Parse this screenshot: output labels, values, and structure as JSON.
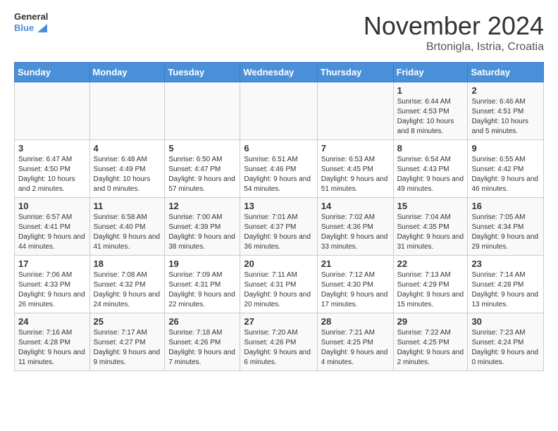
{
  "header": {
    "logo_line1": "General",
    "logo_line2": "Blue",
    "month": "November 2024",
    "location": "Brtonigla, Istria, Croatia"
  },
  "weekdays": [
    "Sunday",
    "Monday",
    "Tuesday",
    "Wednesday",
    "Thursday",
    "Friday",
    "Saturday"
  ],
  "weeks": [
    [
      {
        "day": "",
        "info": ""
      },
      {
        "day": "",
        "info": ""
      },
      {
        "day": "",
        "info": ""
      },
      {
        "day": "",
        "info": ""
      },
      {
        "day": "",
        "info": ""
      },
      {
        "day": "1",
        "info": "Sunrise: 6:44 AM\nSunset: 4:53 PM\nDaylight: 10 hours and 8 minutes."
      },
      {
        "day": "2",
        "info": "Sunrise: 6:46 AM\nSunset: 4:51 PM\nDaylight: 10 hours and 5 minutes."
      }
    ],
    [
      {
        "day": "3",
        "info": "Sunrise: 6:47 AM\nSunset: 4:50 PM\nDaylight: 10 hours and 2 minutes."
      },
      {
        "day": "4",
        "info": "Sunrise: 6:48 AM\nSunset: 4:49 PM\nDaylight: 10 hours and 0 minutes."
      },
      {
        "day": "5",
        "info": "Sunrise: 6:50 AM\nSunset: 4:47 PM\nDaylight: 9 hours and 57 minutes."
      },
      {
        "day": "6",
        "info": "Sunrise: 6:51 AM\nSunset: 4:46 PM\nDaylight: 9 hours and 54 minutes."
      },
      {
        "day": "7",
        "info": "Sunrise: 6:53 AM\nSunset: 4:45 PM\nDaylight: 9 hours and 51 minutes."
      },
      {
        "day": "8",
        "info": "Sunrise: 6:54 AM\nSunset: 4:43 PM\nDaylight: 9 hours and 49 minutes."
      },
      {
        "day": "9",
        "info": "Sunrise: 6:55 AM\nSunset: 4:42 PM\nDaylight: 9 hours and 46 minutes."
      }
    ],
    [
      {
        "day": "10",
        "info": "Sunrise: 6:57 AM\nSunset: 4:41 PM\nDaylight: 9 hours and 44 minutes."
      },
      {
        "day": "11",
        "info": "Sunrise: 6:58 AM\nSunset: 4:40 PM\nDaylight: 9 hours and 41 minutes."
      },
      {
        "day": "12",
        "info": "Sunrise: 7:00 AM\nSunset: 4:39 PM\nDaylight: 9 hours and 38 minutes."
      },
      {
        "day": "13",
        "info": "Sunrise: 7:01 AM\nSunset: 4:37 PM\nDaylight: 9 hours and 36 minutes."
      },
      {
        "day": "14",
        "info": "Sunrise: 7:02 AM\nSunset: 4:36 PM\nDaylight: 9 hours and 33 minutes."
      },
      {
        "day": "15",
        "info": "Sunrise: 7:04 AM\nSunset: 4:35 PM\nDaylight: 9 hours and 31 minutes."
      },
      {
        "day": "16",
        "info": "Sunrise: 7:05 AM\nSunset: 4:34 PM\nDaylight: 9 hours and 29 minutes."
      }
    ],
    [
      {
        "day": "17",
        "info": "Sunrise: 7:06 AM\nSunset: 4:33 PM\nDaylight: 9 hours and 26 minutes."
      },
      {
        "day": "18",
        "info": "Sunrise: 7:08 AM\nSunset: 4:32 PM\nDaylight: 9 hours and 24 minutes."
      },
      {
        "day": "19",
        "info": "Sunrise: 7:09 AM\nSunset: 4:31 PM\nDaylight: 9 hours and 22 minutes."
      },
      {
        "day": "20",
        "info": "Sunrise: 7:11 AM\nSunset: 4:31 PM\nDaylight: 9 hours and 20 minutes."
      },
      {
        "day": "21",
        "info": "Sunrise: 7:12 AM\nSunset: 4:30 PM\nDaylight: 9 hours and 17 minutes."
      },
      {
        "day": "22",
        "info": "Sunrise: 7:13 AM\nSunset: 4:29 PM\nDaylight: 9 hours and 15 minutes."
      },
      {
        "day": "23",
        "info": "Sunrise: 7:14 AM\nSunset: 4:28 PM\nDaylight: 9 hours and 13 minutes."
      }
    ],
    [
      {
        "day": "24",
        "info": "Sunrise: 7:16 AM\nSunset: 4:28 PM\nDaylight: 9 hours and 11 minutes."
      },
      {
        "day": "25",
        "info": "Sunrise: 7:17 AM\nSunset: 4:27 PM\nDaylight: 9 hours and 9 minutes."
      },
      {
        "day": "26",
        "info": "Sunrise: 7:18 AM\nSunset: 4:26 PM\nDaylight: 9 hours and 7 minutes."
      },
      {
        "day": "27",
        "info": "Sunrise: 7:20 AM\nSunset: 4:26 PM\nDaylight: 9 hours and 6 minutes."
      },
      {
        "day": "28",
        "info": "Sunrise: 7:21 AM\nSunset: 4:25 PM\nDaylight: 9 hours and 4 minutes."
      },
      {
        "day": "29",
        "info": "Sunrise: 7:22 AM\nSunset: 4:25 PM\nDaylight: 9 hours and 2 minutes."
      },
      {
        "day": "30",
        "info": "Sunrise: 7:23 AM\nSunset: 4:24 PM\nDaylight: 9 hours and 0 minutes."
      }
    ]
  ]
}
